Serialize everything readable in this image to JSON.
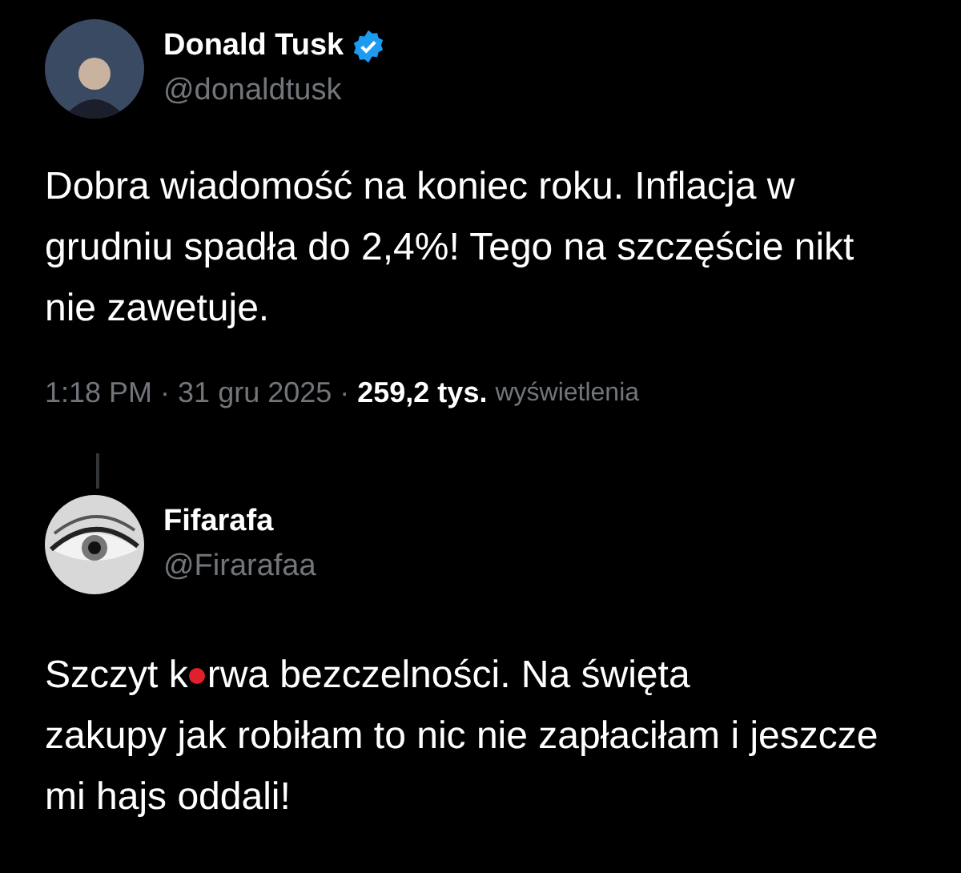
{
  "tweet": {
    "author": {
      "name": "Donald Tusk",
      "handle": "@donaldtusk",
      "verified": true
    },
    "text": "Dobra wiadomość na koniec roku. Inflacja w grudniu spadła do 2,4%! Tego na szczęście nikt nie zawetuje.",
    "time": "1:18 PM",
    "separator_1": "·",
    "date": "31 gru 2025",
    "separator_2": "·",
    "views": "259,2 tys.",
    "views_label": "wyświetlenia"
  },
  "reply": {
    "author": {
      "name": "Fifarafa",
      "handle": "@Firarafaa"
    },
    "text_before_censor": "Szczyt k",
    "text_after_censor": "rwa bezczelności. Na święta",
    "text_continued": "zakupy jak robiłam to nic nie zapłaciłam i jeszcze mi hajs oddali!"
  }
}
